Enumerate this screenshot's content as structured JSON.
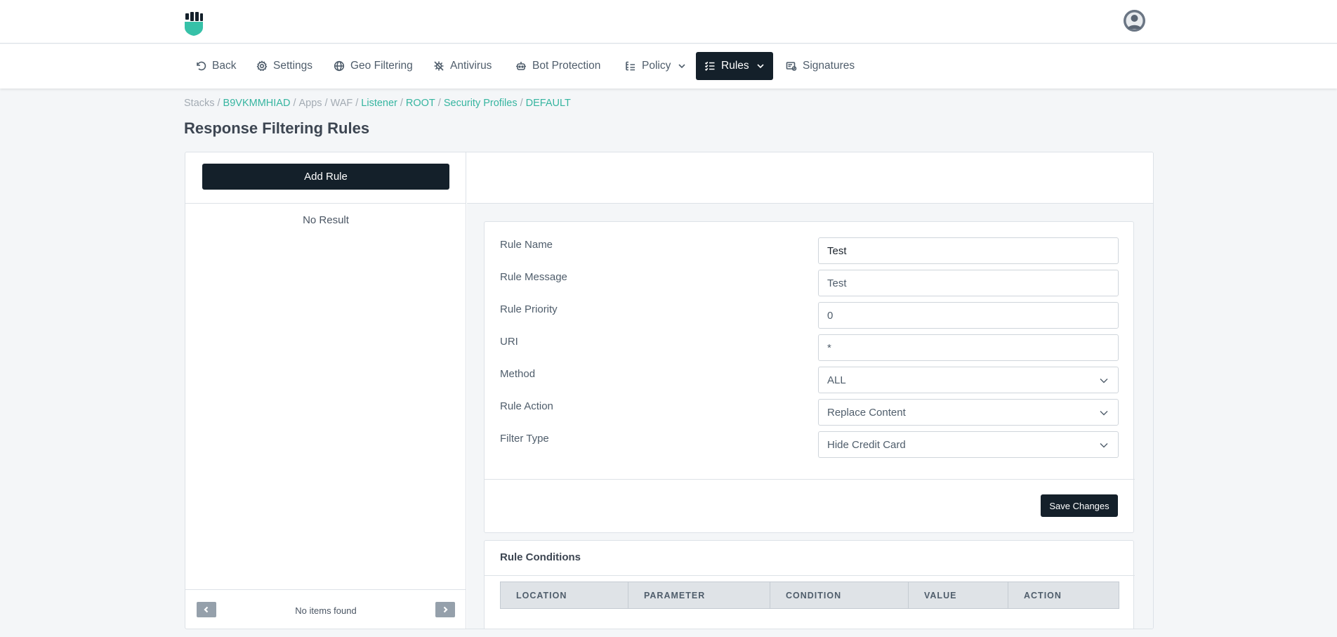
{
  "nav": {
    "items": [
      {
        "label": "Back",
        "icon": "back-icon"
      },
      {
        "label": "Settings",
        "icon": "gear-icon"
      },
      {
        "label": "Geo Filtering",
        "icon": "globe-icon"
      },
      {
        "label": "Antivirus",
        "icon": "virus-icon"
      },
      {
        "label": "Bot Protection",
        "icon": "robot-icon"
      },
      {
        "label": "Policy",
        "icon": "list-tree-icon"
      },
      {
        "label": "Rules",
        "icon": "checklist-icon"
      },
      {
        "label": "Signatures",
        "icon": "signature-icon"
      }
    ],
    "active": "Rules"
  },
  "breadcrumb": {
    "stacks": "Stacks",
    "stack_id": "B9VKMMHIAD",
    "apps": "Apps",
    "waf": "WAF",
    "listener": "Listener",
    "root": "ROOT",
    "security_profiles": "Security Profiles",
    "default": "DEFAULT",
    "separator": "/"
  },
  "page": {
    "title": "Response Filtering Rules"
  },
  "left": {
    "add_rule_label": "Add Rule",
    "empty_text": "No Result",
    "footer_text": "No items found"
  },
  "form": {
    "rule_name": {
      "label": "Rule Name",
      "value": "Test"
    },
    "rule_message": {
      "label": "Rule Message",
      "value": "Test"
    },
    "rule_priority": {
      "label": "Rule Priority",
      "value": "0"
    },
    "uri": {
      "label": "URI",
      "value": "*"
    },
    "method": {
      "label": "Method",
      "value": "ALL"
    },
    "rule_action": {
      "label": "Rule Action",
      "value": "Replace Content"
    },
    "filter_type": {
      "label": "Filter Type",
      "value": "Hide Credit Card"
    },
    "save_label": "Save Changes"
  },
  "conditions": {
    "title": "Rule Conditions",
    "columns": [
      "LOCATION",
      "PARAMETER",
      "CONDITION",
      "VALUE",
      "ACTION"
    ]
  },
  "colors": {
    "dark": "#14202a",
    "accent": "#36b5a0",
    "background": "#f4f6f8"
  }
}
